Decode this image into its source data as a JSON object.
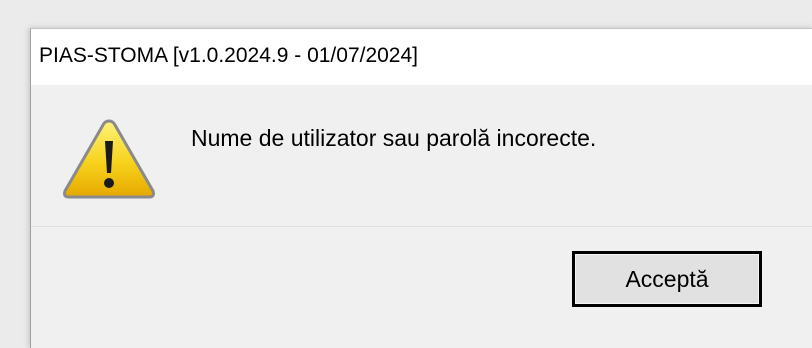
{
  "window": {
    "title": "PIAS-STOMA [v1.0.2024.9 - 01/07/2024]"
  },
  "message_box": {
    "icon": "warning-icon",
    "message": "Nume de utilizator sau parolă incorecte.",
    "ok_label": "Acceptă"
  },
  "colors": {
    "titlebar_bg": "#ffffff",
    "body_bg": "#f0f0f0",
    "warning_yellow": "#f5c400",
    "button_border": "#000000"
  }
}
